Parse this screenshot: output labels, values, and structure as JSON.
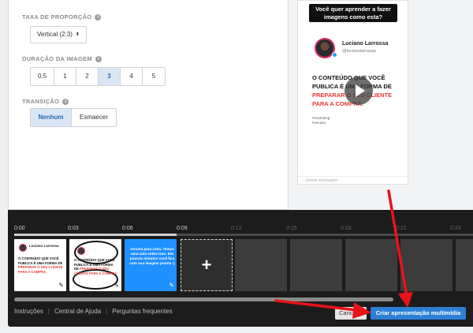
{
  "settings": {
    "aspect_label": "TAXA DE PROPORÇÃO",
    "aspect_value": "Vertical (2:3)",
    "duration_label": "DURAÇÃO DA IMAGEM",
    "durations": [
      "0.5",
      "1",
      "2",
      "3",
      "4",
      "5"
    ],
    "duration_selected": "3",
    "transition_label": "TRANSIÇÃO",
    "transitions": [
      "Nenhum",
      "Esmaecer"
    ],
    "transition_selected": "Nenhum"
  },
  "preview": {
    "question": "Você quer aprender a fazer imagens como esta?",
    "profile_name": "Luciano Larrossa",
    "profile_handle": "@lucianolarrossa",
    "headline_black_1": "O CONTEÚDO QUE VOCÊ PUBLICA É UMA FORMA DE ",
    "headline_red_1": "PREPARAR O SEU CLIENTE PARA A COMPRA.",
    "tag_1": "#marketing",
    "tag_2": "#vendas",
    "bottom_hint": "Enviar mensagem"
  },
  "timeline": {
    "ticks": [
      "0:00",
      "0:03",
      "0:06",
      "0:09",
      "0:12",
      "0:15",
      "0:18",
      "0:21",
      "0:24"
    ],
    "slide1_name": "Luciano Larrossa",
    "slide1_text_black": "O CONTEÚDO QUE VOCÊ PUBLICA É UMA FORMA DE ",
    "slide1_text_red": "PREPARAR O SEU CLIENTE PARA A COMPRA.",
    "slide3_text": "Arrasta para cima. Temos uma aula sobre isso. Em poucos minutos você fica com sua imagem pronta :)",
    "add_label": "+"
  },
  "footer": {
    "links": [
      "Instruções",
      "Central de Ajuda",
      "Perguntas frequentes"
    ],
    "cancel_label": "Cancelar",
    "create_label": "Criar apresentação multimídia"
  },
  "colors": {
    "accent": "#2d7fd6",
    "annotation_arrow": "#e8121b",
    "highlight_red": "#e53935"
  }
}
